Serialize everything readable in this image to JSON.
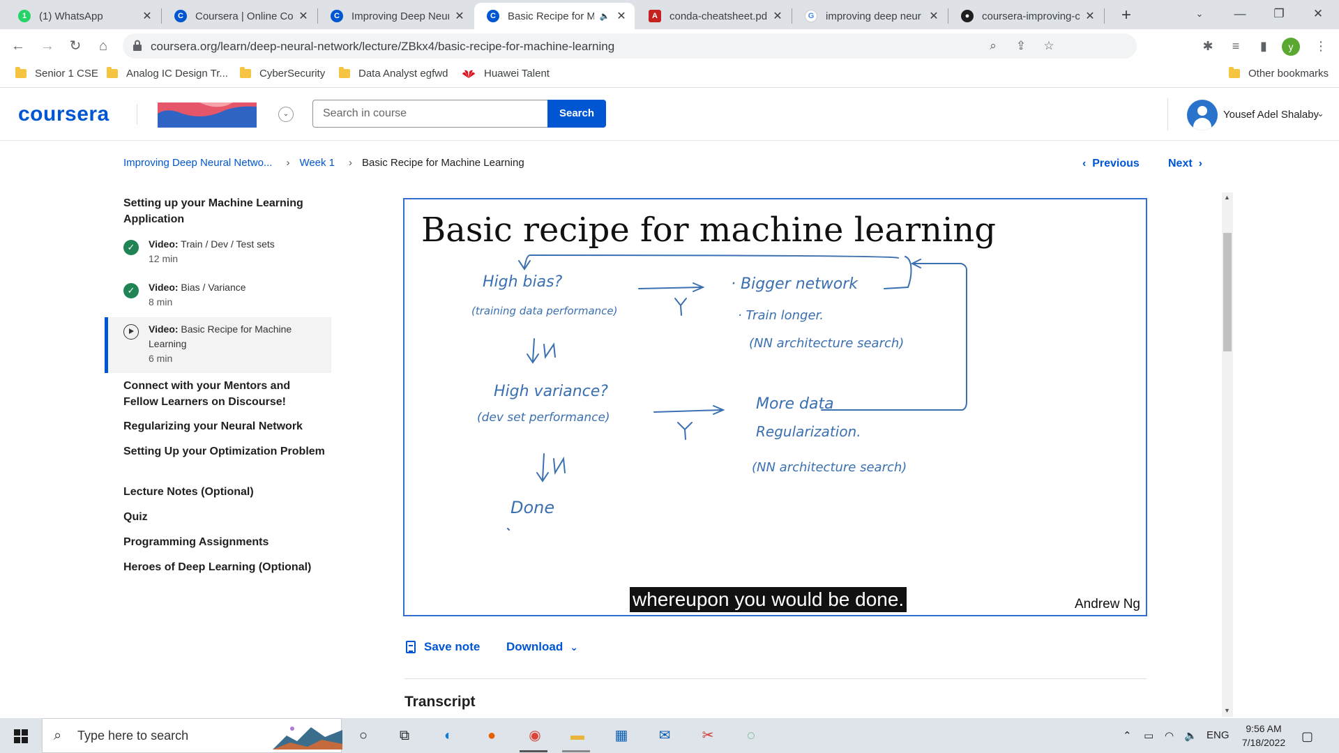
{
  "browser": {
    "tabs": [
      {
        "title": "(1) WhatsApp",
        "favicon": "whatsapp-icon",
        "color": "#25d366",
        "badge": "1"
      },
      {
        "title": "Coursera | Online Cou",
        "favicon": "coursera-icon",
        "color": "#0056d2",
        "badge": "C"
      },
      {
        "title": "Improving Deep Neur",
        "favicon": "coursera-icon",
        "color": "#0056d2",
        "badge": "C"
      },
      {
        "title": "Basic Recipe for M",
        "favicon": "coursera-icon",
        "color": "#0056d2",
        "badge": "C",
        "active": true
      },
      {
        "title": "conda-cheatsheet.pdf",
        "favicon": "pdf-icon",
        "color": "#c5221f",
        "badge": "A"
      },
      {
        "title": "improving deep neur",
        "favicon": "google-icon",
        "color": "#4285f4",
        "badge": "G"
      },
      {
        "title": "coursera-improving-c",
        "favicon": "github-icon",
        "color": "#1f1f1f",
        "badge": "●"
      }
    ],
    "url": "coursera.org/learn/deep-neural-network/lecture/ZBkx4/basic-recipe-for-machine-learning",
    "profile_initial": "y",
    "bookmarks": [
      {
        "label": "Senior 1 CSE",
        "icon": "folder-icon"
      },
      {
        "label": "Analog IC Design Tr...",
        "icon": "folder-icon"
      },
      {
        "label": "CyberSecurity",
        "icon": "folder-icon"
      },
      {
        "label": "Data Analyst egfwd",
        "icon": "folder-icon"
      },
      {
        "label": "Huawei Talent",
        "icon": "huawei-icon"
      }
    ],
    "other_bookmarks": "Other bookmarks"
  },
  "header": {
    "logo": "coursera",
    "search_placeholder": "Search in course",
    "search_button": "Search",
    "user_name": "Yousef Adel Shalaby"
  },
  "breadcrumb": {
    "course": "Improving Deep Neural Netwo...",
    "week": "Week 1",
    "current": "Basic Recipe for Machine Learning"
  },
  "pager": {
    "previous": "Previous",
    "next": "Next"
  },
  "sidebar": {
    "section1": "Setting up your Machine Learning Application",
    "items": [
      {
        "kind": "Video:",
        "title": "Train / Dev / Test sets",
        "duration": "12 min",
        "status": "complete"
      },
      {
        "kind": "Video:",
        "title": "Bias / Variance",
        "duration": "8 min",
        "status": "complete"
      },
      {
        "kind": "Video:",
        "title": "Basic Recipe for Machine Learning",
        "duration": "6 min",
        "status": "current"
      }
    ],
    "sections": [
      "Connect with your Mentors and Fellow Learners on Discourse!",
      "Regularizing your Neural Network",
      "Setting Up your Optimization Problem",
      "Lecture Notes (Optional)",
      "Quiz",
      "Programming Assignments",
      "Heroes of Deep Learning (Optional)"
    ]
  },
  "video": {
    "slide_title": "Basic recipe for machine learning",
    "caption": "whereupon you would be done.",
    "author": "Andrew Ng",
    "handwriting": {
      "q1": "High bias?",
      "q1_note": "(training data performance)",
      "yes1": "Y",
      "no1": "N",
      "a1_1": "· Bigger network",
      "a1_2": "· Train longer.",
      "a1_3": "(NN architecture search)",
      "q2": "High variance?",
      "q2_note": "(dev set performance)",
      "yes2": "Y",
      "no2": "N",
      "a2_1": "More data",
      "a2_2": "Regularization.",
      "a2_3": "(NN architecture search)",
      "done": "Done"
    }
  },
  "below": {
    "save_note": "Save note",
    "download": "Download",
    "transcript": "Transcript"
  },
  "taskbar": {
    "search_placeholder": "Type here to search",
    "language": "ENG",
    "time": "9:56 AM",
    "date": "7/18/2022"
  }
}
